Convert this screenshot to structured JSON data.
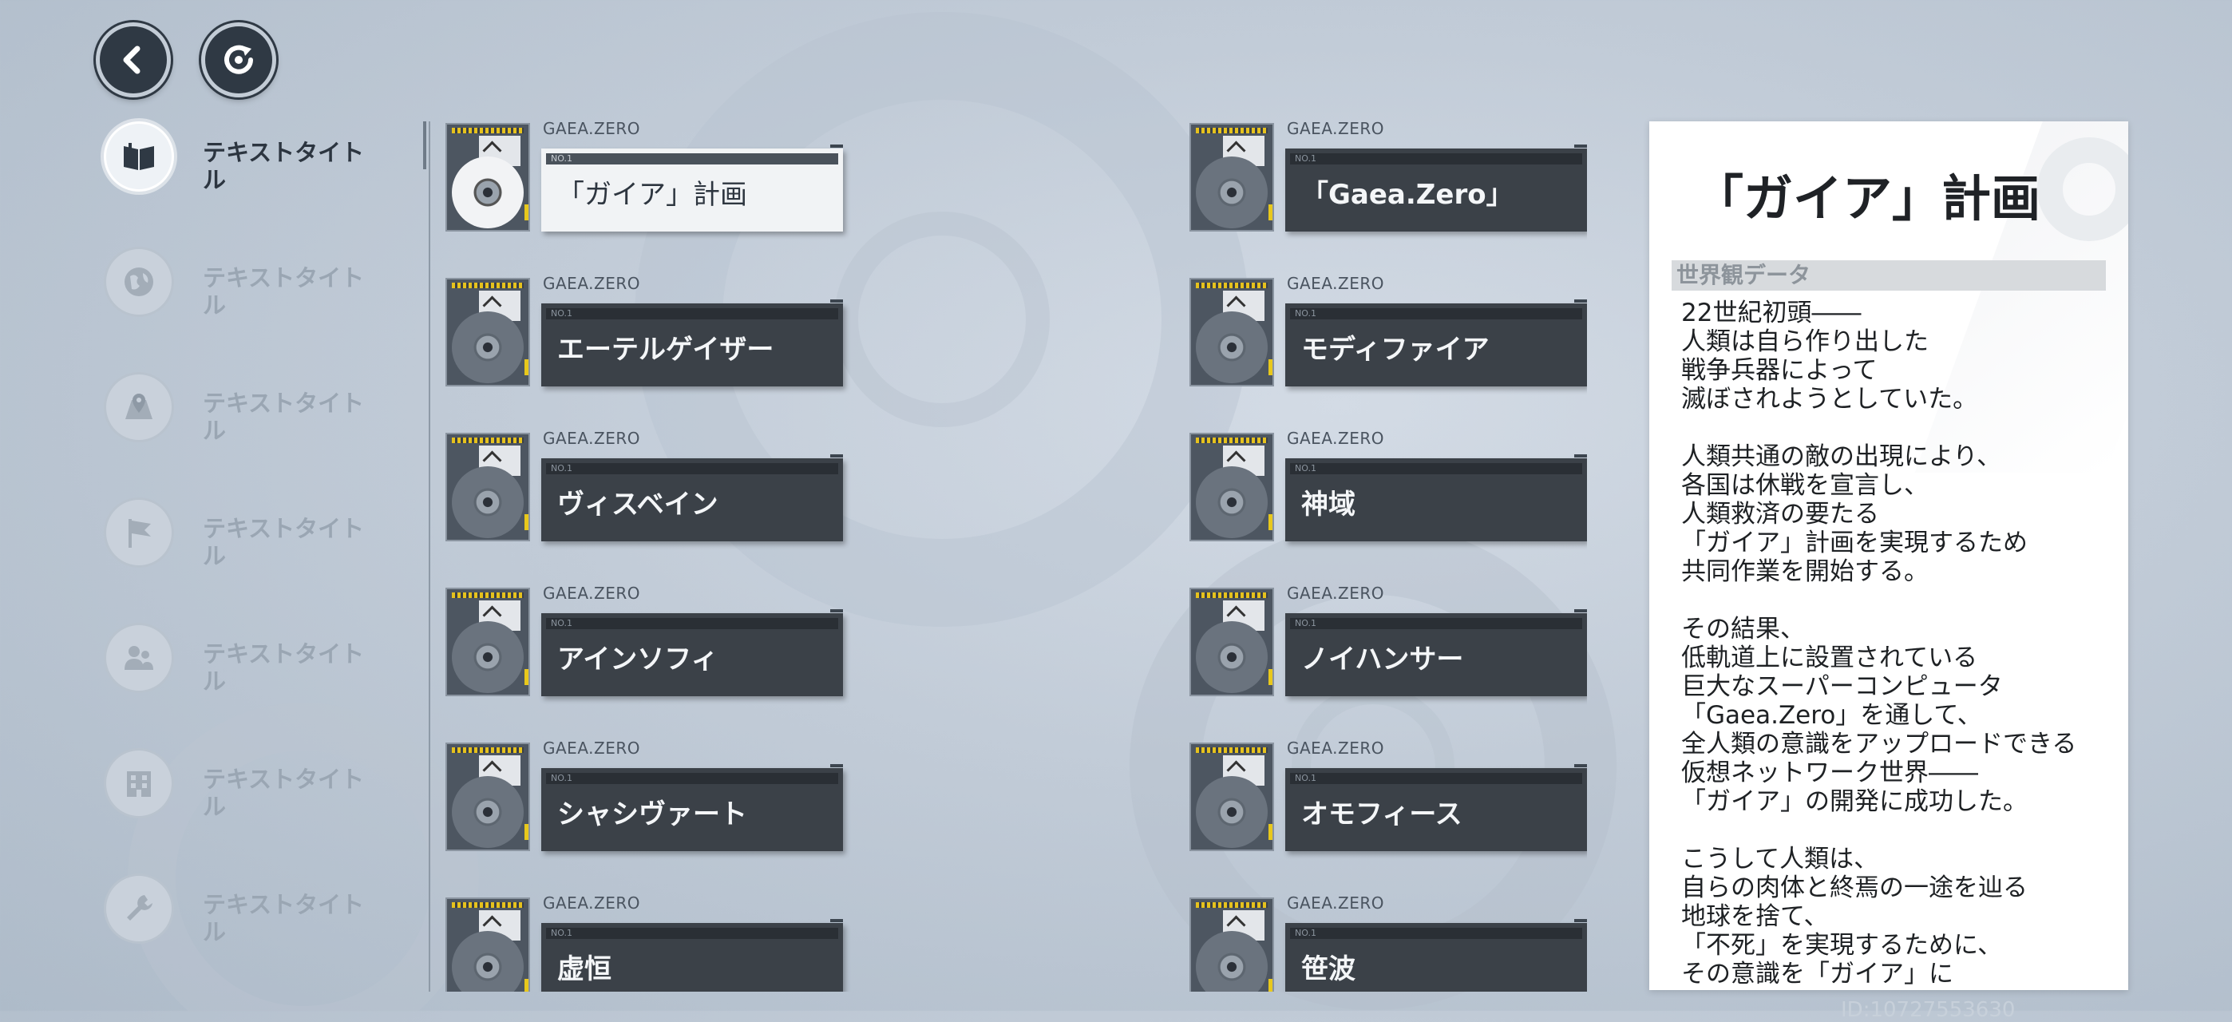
{
  "toolbar": {
    "back_icon": "chevron-left-icon",
    "reload_icon": "refresh-icon"
  },
  "sidebar": {
    "items": [
      {
        "label": "テキストタイトル",
        "icon": "book-icon",
        "active": true
      },
      {
        "label": "テキストタイトル",
        "icon": "globe-icon",
        "active": false
      },
      {
        "label": "テキストタイトル",
        "icon": "map-pin-icon",
        "active": false
      },
      {
        "label": "テキストタイトル",
        "icon": "flag-icon",
        "active": false
      },
      {
        "label": "テキストタイトル",
        "icon": "people-icon",
        "active": false
      },
      {
        "label": "テキストタイトル",
        "icon": "building-icon",
        "active": false
      },
      {
        "label": "テキストタイトル",
        "icon": "wrench-icon",
        "active": false
      }
    ]
  },
  "cards": [
    {
      "brand": "GAEA.ZERO",
      "no": "NO.1",
      "title": "「ガイア」計画",
      "selected": true
    },
    {
      "brand": "GAEA.ZERO",
      "no": "NO.1",
      "title": "「Gaea.Zero」",
      "selected": false
    },
    {
      "brand": "GAEA.ZERO",
      "no": "NO.1",
      "title": "エーテルゲイザー",
      "selected": false
    },
    {
      "brand": "GAEA.ZERO",
      "no": "NO.1",
      "title": "モディファイア",
      "selected": false
    },
    {
      "brand": "GAEA.ZERO",
      "no": "NO.1",
      "title": "ヴィスベイン",
      "selected": false
    },
    {
      "brand": "GAEA.ZERO",
      "no": "NO.1",
      "title": "神域",
      "selected": false
    },
    {
      "brand": "GAEA.ZERO",
      "no": "NO.1",
      "title": "アインソフィ",
      "selected": false
    },
    {
      "brand": "GAEA.ZERO",
      "no": "NO.1",
      "title": "ノイハンサー",
      "selected": false
    },
    {
      "brand": "GAEA.ZERO",
      "no": "NO.1",
      "title": "シャシヴァート",
      "selected": false
    },
    {
      "brand": "GAEA.ZERO",
      "no": "NO.1",
      "title": "オモフィース",
      "selected": false
    },
    {
      "brand": "GAEA.ZERO",
      "no": "NO.1",
      "title": "虚恒",
      "selected": false
    },
    {
      "brand": "GAEA.ZERO",
      "no": "NO.1",
      "title": "笹波",
      "selected": false
    }
  ],
  "detail": {
    "title": "「ガイア」計画",
    "section": "世界観データ",
    "body": "22世紀初頭――\n人類は自ら作り出した\n戦争兵器によって\n滅ぼされようとしていた。\n\n人類共通の敵の出現により、\n各国は休戦を宣言し、\n人類救済の要たる\n「ガイア」計画を実現するため\n共同作業を開始する。\n\nその結果、\n低軌道上に設置されている\n巨大なスーパーコンピュータ\n「Gaea.Zero」を通して、\n全人類の意識をアップロードできる\n仮想ネットワーク世界――\n「ガイア」の開発に成功した。\n\nこうして人類は、\n自らの肉体と終焉の一途を辿る\n地球を捨て、\n「不死」を実現するために、\nその意識を「ガイア」に"
  },
  "footer": {
    "id_text": "ID:10727553630"
  }
}
